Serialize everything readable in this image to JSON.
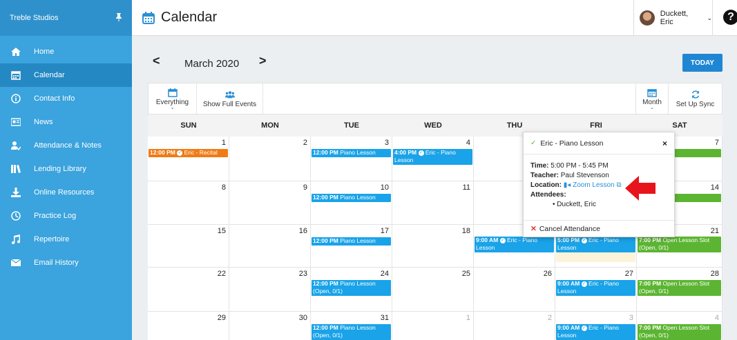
{
  "sidebar": {
    "org_name": "Treble Studios",
    "items": [
      {
        "label": "Home",
        "icon": "home-icon"
      },
      {
        "label": "Calendar",
        "icon": "calendar-icon",
        "active": true
      },
      {
        "label": "Contact Info",
        "icon": "info-icon"
      },
      {
        "label": "News",
        "icon": "news-icon"
      },
      {
        "label": "Attendance & Notes",
        "icon": "attendance-icon"
      },
      {
        "label": "Lending Library",
        "icon": "library-icon"
      },
      {
        "label": "Online Resources",
        "icon": "download-icon"
      },
      {
        "label": "Practice Log",
        "icon": "clock-icon"
      },
      {
        "label": "Repertoire",
        "icon": "music-note-icon"
      },
      {
        "label": "Email History",
        "icon": "mail-icon"
      }
    ]
  },
  "header": {
    "title": "Calendar",
    "user_name": "Duckett, Eric",
    "help": "?"
  },
  "nav": {
    "month_label": "March 2020",
    "prev": "<",
    "next": ">",
    "today": "TODAY"
  },
  "toolbar": {
    "everything": "Everything",
    "show_full": "Show Full Events",
    "month": "Month",
    "sync": "Set Up Sync"
  },
  "days": [
    "SUN",
    "MON",
    "TUE",
    "WED",
    "THU",
    "FRI",
    "SAT"
  ],
  "weeks": [
    {
      "nums": [
        "1",
        "2",
        "3",
        "4",
        "5",
        "6",
        "7"
      ],
      "dim": [
        false,
        false,
        false,
        false,
        false,
        false,
        false
      ]
    },
    {
      "nums": [
        "8",
        "9",
        "10",
        "11",
        "12",
        "13",
        "14"
      ],
      "dim": [
        false,
        false,
        false,
        false,
        false,
        false,
        false
      ]
    },
    {
      "nums": [
        "15",
        "16",
        "17",
        "18",
        "19",
        "20",
        "21"
      ],
      "dim": [
        false,
        false,
        false,
        false,
        false,
        false,
        false
      ]
    },
    {
      "nums": [
        "22",
        "23",
        "24",
        "25",
        "26",
        "27",
        "28"
      ],
      "dim": [
        false,
        false,
        false,
        false,
        false,
        false,
        false
      ]
    },
    {
      "nums": [
        "29",
        "30",
        "31",
        "1",
        "2",
        "3",
        "4"
      ],
      "dim": [
        false,
        false,
        false,
        true,
        true,
        true,
        true
      ]
    }
  ],
  "events": [
    {
      "week": 0,
      "day": 0,
      "time": "12:00 PM",
      "text": "Eric - Recital",
      "color": "orange",
      "check": true,
      "lines": 1
    },
    {
      "week": 0,
      "day": 2,
      "time": "12:00 PM",
      "text": "Piano Lesson",
      "color": "blue",
      "check": false,
      "lines": 1
    },
    {
      "week": 0,
      "day": 3,
      "time": "4:00 PM",
      "text": "Eric - Piano Lesson",
      "color": "blue",
      "check": true,
      "lines": 2
    },
    {
      "week": 0,
      "day": 6,
      "time": "",
      "text": "n Lesson Slot",
      "color": "green",
      "check": false,
      "lines": 1
    },
    {
      "week": 1,
      "day": 2,
      "time": "12:00 PM",
      "text": "Piano Lesson",
      "color": "blue",
      "check": false,
      "lines": 1
    },
    {
      "week": 1,
      "day": 6,
      "time": "",
      "text": "n Lesson Slot",
      "color": "green",
      "check": false,
      "lines": 1
    },
    {
      "week": 2,
      "day": 2,
      "time": "12:00 PM",
      "text": "Piano Lesson",
      "color": "blue",
      "check": false,
      "lines": 1
    },
    {
      "week": 2,
      "day": 4,
      "time": "9:00 AM",
      "text": "Eric - Piano Lesson",
      "color": "blue",
      "check": true,
      "lines": 2
    },
    {
      "week": 2,
      "day": 5,
      "time": "5:00 PM",
      "text": "Eric - Piano Lesson",
      "color": "blue",
      "check": true,
      "lines": 2
    },
    {
      "week": 2,
      "day": 6,
      "time": "7:00 PM",
      "text": "Open Lesson Slot (Open, 0/1)",
      "color": "green",
      "check": false,
      "lines": 2
    },
    {
      "week": 3,
      "day": 2,
      "time": "12:00 PM",
      "text": "Piano Lesson (Open, 0/1)",
      "color": "blue",
      "check": false,
      "lines": 2
    },
    {
      "week": 3,
      "day": 5,
      "time": "9:00 AM",
      "text": "Eric - Piano Lesson",
      "color": "blue",
      "check": true,
      "lines": 2
    },
    {
      "week": 3,
      "day": 6,
      "time": "7:00 PM",
      "text": "Open Lesson Slot (Open, 0/1)",
      "color": "green",
      "check": false,
      "lines": 2
    },
    {
      "week": 4,
      "day": 2,
      "time": "12:00 PM",
      "text": "Piano Lesson (Open, 0/1)",
      "color": "blue",
      "check": false,
      "lines": 2
    },
    {
      "week": 4,
      "day": 5,
      "time": "9:00 AM",
      "text": "Eric - Piano Lesson",
      "color": "blue",
      "check": true,
      "lines": 2
    },
    {
      "week": 4,
      "day": 6,
      "time": "7:00 PM",
      "text": "Open Lesson Slot (Open, 0/1)",
      "color": "green",
      "check": false,
      "lines": 2
    }
  ],
  "popup": {
    "title": "Eric - Piano Lesson",
    "time_label": "Time:",
    "time_value": "5:00 PM - 5:45 PM",
    "teacher_label": "Teacher:",
    "teacher_value": "Paul Stevenson",
    "location_label": "Location:",
    "location_value": "Zoom Lesson",
    "attendees_label": "Attendees:",
    "attendee": "Duckett, Eric",
    "cancel": "Cancel Attendance",
    "close": "×"
  },
  "colors": {
    "sidebar": "#3ba3dd",
    "sidebar_active": "#2488c3",
    "event_blue": "#1aa3e8",
    "event_orange": "#f07b16",
    "event_green": "#5cb532",
    "today_button": "#1f86d4",
    "arrow": "#e8141c"
  }
}
